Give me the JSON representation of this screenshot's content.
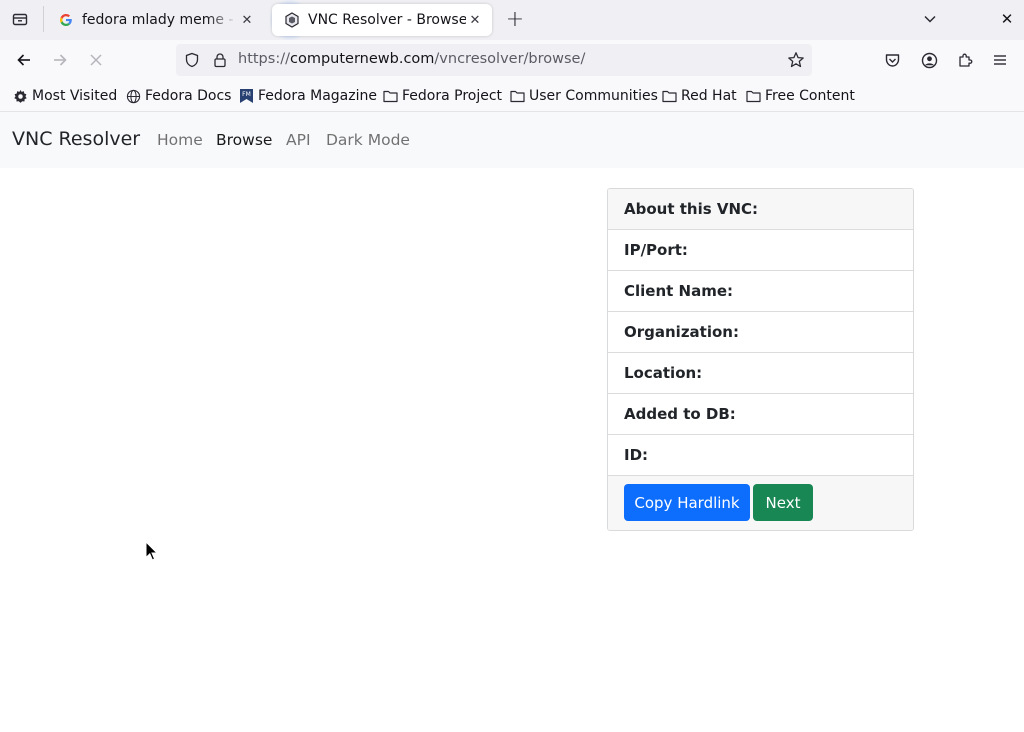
{
  "browser": {
    "tabs": [
      {
        "title": "fedora mlady meme - Google Search",
        "favicon": "google-g-icon",
        "active": false
      },
      {
        "title": "VNC Resolver - Browse",
        "favicon": "vnc-resolver-icon",
        "active": true
      }
    ],
    "url": {
      "prefix": "https://",
      "host": "computernewb.com",
      "path": "/vncresolver/browse/"
    },
    "bookmarks": [
      {
        "label": "Most Visited",
        "icon": "gear-icon"
      },
      {
        "label": "Fedora Docs",
        "icon": "globe-icon"
      },
      {
        "label": "Fedora Magazine",
        "icon": "fedora-magazine-icon"
      },
      {
        "label": "Fedora Project",
        "icon": "folder-icon"
      },
      {
        "label": "User Communities",
        "icon": "folder-icon"
      },
      {
        "label": "Red Hat",
        "icon": "folder-icon"
      },
      {
        "label": "Free Content",
        "icon": "folder-icon"
      }
    ]
  },
  "site": {
    "brand": "VNC Resolver",
    "nav": [
      {
        "label": "Home",
        "active": false
      },
      {
        "label": "Browse",
        "active": true
      },
      {
        "label": "API",
        "active": false
      },
      {
        "label": "Dark Mode",
        "active": false
      }
    ]
  },
  "card": {
    "header": "About this VNC:",
    "rows": [
      {
        "label": "IP/Port:"
      },
      {
        "label": "Client Name:"
      },
      {
        "label": "Organization:"
      },
      {
        "label": "Location:"
      },
      {
        "label": "Added to DB:"
      },
      {
        "label": "ID:"
      }
    ],
    "buttons": {
      "copy_hardlink": "Copy Hardlink",
      "next": "Next"
    }
  },
  "colors": {
    "primary": "#0d6efd",
    "success": "#198754",
    "navbar_bg": "#f8f9fa",
    "tabstrip_bg": "#f0f0f4"
  }
}
